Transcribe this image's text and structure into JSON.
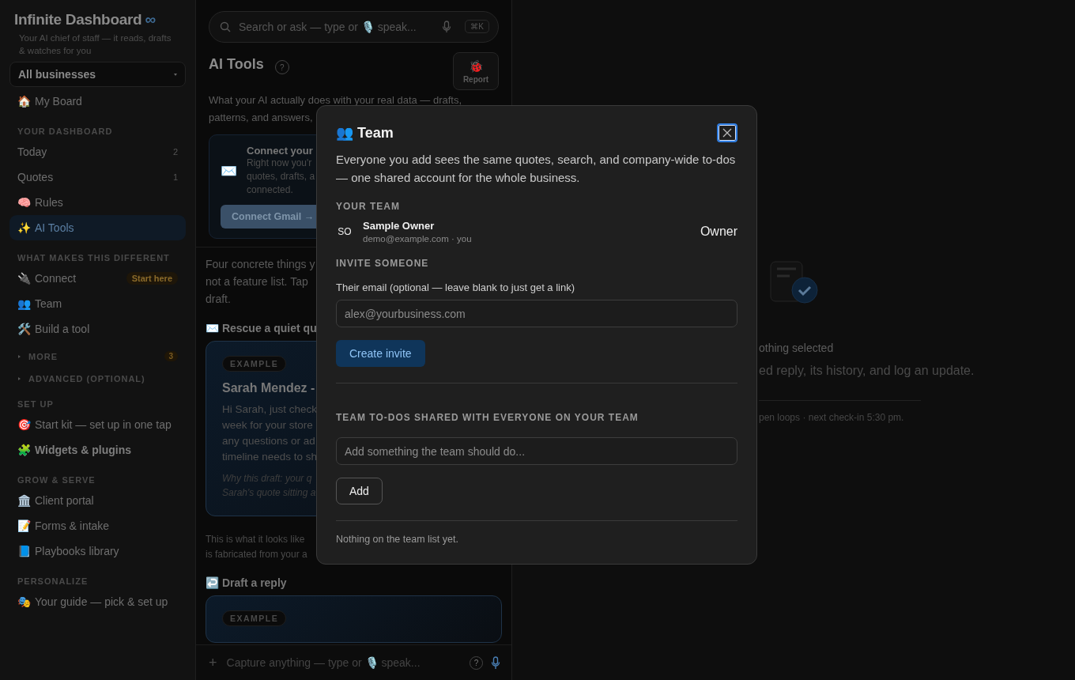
{
  "sidebar": {
    "brand": {
      "name": "Infinite Dashboard",
      "mark": "∞"
    },
    "tagline": "Your AI chief of staff — it reads, drafts & watches for you",
    "business_select": {
      "value": "All businesses"
    },
    "home": {
      "icon": "🏠",
      "label": "My Board",
      "selected": false
    },
    "groups": [
      {
        "kind": "section",
        "title": "YOUR DASHBOARD",
        "items": [
          {
            "label": "Today",
            "count": "2",
            "selected": false
          },
          {
            "label": "Quotes",
            "count": "1",
            "selected": false
          },
          {
            "icon": "🧠",
            "label": "Rules",
            "selected": false
          },
          {
            "icon": "✨",
            "label": "AI Tools",
            "selected": true
          }
        ]
      },
      {
        "kind": "section",
        "title": "WHAT MAKES THIS DIFFERENT",
        "items": [
          {
            "icon": "🔌",
            "label": "Connect",
            "badge": "Start here",
            "selected": false
          },
          {
            "icon": "👥",
            "label": "Team",
            "selected": false
          },
          {
            "icon": "🛠️",
            "label": "Build a tool",
            "selected": false
          }
        ]
      },
      {
        "kind": "collapsible",
        "title": "MORE",
        "count": "3",
        "expanded": false
      },
      {
        "kind": "collapsible",
        "title": "ADVANCED (OPTIONAL)",
        "expanded": false
      },
      {
        "kind": "section",
        "title": "SET UP",
        "items": [
          {
            "icon": "🎯",
            "label": "Start kit — set up in one tap",
            "selected": false,
            "emphasized": false
          },
          {
            "icon": "🧩",
            "label": "Widgets & plugins",
            "selected": false,
            "emphasized": true
          }
        ]
      },
      {
        "kind": "section",
        "title": "GROW & SERVE",
        "items": [
          {
            "icon": "🏛️",
            "label": "Client portal",
            "selected": false
          },
          {
            "icon": "📝",
            "label": "Forms & intake",
            "selected": false
          },
          {
            "icon": "📘",
            "label": "Playbooks library",
            "selected": false
          }
        ]
      },
      {
        "kind": "section",
        "title": "PERSONALIZE",
        "items": [
          {
            "icon": "🎭",
            "label": "Your guide — pick & set up",
            "selected": false
          }
        ]
      }
    ]
  },
  "main": {
    "search": {
      "placeholder": "Search or ask — type or 🎙️ speak...",
      "shortcut": "⌘K"
    },
    "title": "AI Tools",
    "help": "?",
    "report": {
      "icon": "🐞",
      "label": "Report"
    },
    "intro_lines": [
      "What your AI actually does with your real data — drafts,",
      "patterns, and answers,"
    ],
    "connect_card": {
      "icon": "✉️",
      "title": "Connect your",
      "body_lines": [
        "Right now you'r",
        "quotes, drafts, a",
        "connected."
      ],
      "button": "Connect Gmail →"
    },
    "lead_lines": [
      "Four concrete things y",
      "not a feature list. Tap",
      "draft."
    ],
    "sections": [
      {
        "icon": "✉️",
        "title": "Rescue a quiet qu",
        "card": {
          "badge": "EXAMPLE",
          "title": "Sarah Mendez -",
          "body_lines": [
            "Hi Sarah, just check",
            "week for your store",
            "any questions or ad",
            "timeline needs to sh"
          ],
          "note_lines": [
            "Why this draft: your q",
            "Sarah's quote sitting a"
          ]
        },
        "caption_lines": [
          "This is what it looks like",
          "is fabricated from your a"
        ]
      },
      {
        "icon": "↩️",
        "title": "Draft a reply",
        "card": {
          "badge": "EXAMPLE"
        }
      }
    ],
    "capture": {
      "plus": "+",
      "placeholder": "Capture anything — type or 🎙️ speak...",
      "help": "?"
    }
  },
  "detail": {
    "title": "othing selected",
    "text": "ed reply, its history, and log an update.",
    "footer": "pen loops · next check-in 5:30 pm."
  },
  "modal": {
    "icon": "👥",
    "title": "Team",
    "description": "Everyone you add sees the same quotes, search, and company-wide to-dos — one shared account for the whole business.",
    "team_title": "YOUR TEAM",
    "members": [
      {
        "initials": "SO",
        "name": "Sample Owner",
        "email": "demo@example.com · you",
        "role": "Owner"
      }
    ],
    "invite": {
      "title": "INVITE SOMEONE",
      "label": "Their email (optional — leave blank to just get a link)",
      "placeholder": "alex@yourbusiness.com",
      "button": "Create invite"
    },
    "todos": {
      "title": "TEAM TO-DOS SHARED WITH EVERYONE ON YOUR TEAM",
      "placeholder": "Add something the team should do...",
      "button": "Add",
      "empty": "Nothing on the team list yet."
    }
  }
}
